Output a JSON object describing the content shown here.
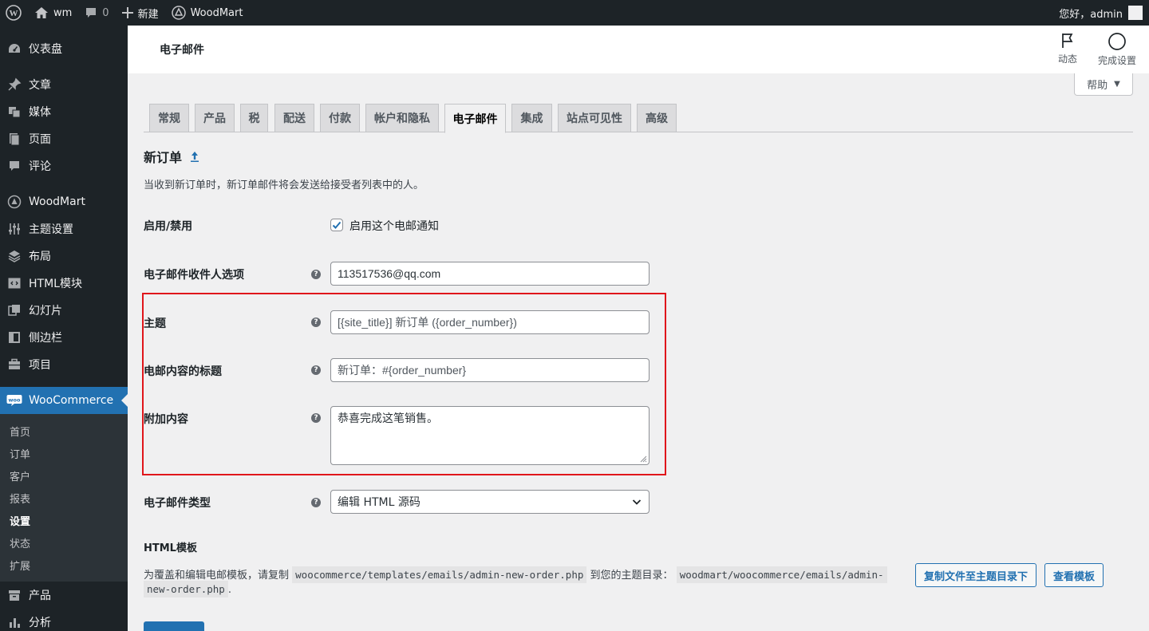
{
  "adminbar": {
    "site_name": "wm",
    "comments_count": "0",
    "new_label": "新建",
    "theme_link": "WoodMart",
    "greeting": "您好，admin"
  },
  "sidebar": {
    "items": [
      {
        "label": "仪表盘",
        "icon": "dashboard-icon"
      },
      {
        "label": "文章",
        "icon": "pin-icon"
      },
      {
        "label": "媒体",
        "icon": "media-icon"
      },
      {
        "label": "页面",
        "icon": "page-icon"
      },
      {
        "label": "评论",
        "icon": "comment-icon"
      },
      {
        "label": "WoodMart",
        "icon": "woodmart-icon"
      },
      {
        "label": "主题设置",
        "icon": "sliders-icon"
      },
      {
        "label": "布局",
        "icon": "layers-icon"
      },
      {
        "label": "HTML模块",
        "icon": "html-block-icon"
      },
      {
        "label": "幻灯片",
        "icon": "slides-icon"
      },
      {
        "label": "侧边栏",
        "icon": "sidebar-icon"
      },
      {
        "label": "项目",
        "icon": "portfolio-icon"
      },
      {
        "label": "WooCommerce",
        "icon": "woo-icon"
      },
      {
        "label": "产品",
        "icon": "archive-icon"
      },
      {
        "label": "分析",
        "icon": "chart-icon"
      }
    ],
    "submenu": [
      "首页",
      "订单",
      "客户",
      "报表",
      "设置",
      "状态",
      "扩展"
    ]
  },
  "header": {
    "title": "电子邮件",
    "activity_label": "动态",
    "finish_setup_label": "完成设置",
    "help_label": "帮助"
  },
  "tabs": [
    "常规",
    "产品",
    "税",
    "配送",
    "付款",
    "帐户和隐私",
    "电子邮件",
    "集成",
    "站点可见性",
    "高级"
  ],
  "active_tab": "电子邮件",
  "form": {
    "section_title": "新订单",
    "description": "当收到新订单时，新订单邮件将会发送给接受者列表中的人。",
    "enable_label": "启用/禁用",
    "enable_checkbox_label": "启用这个电邮通知",
    "enable_checked": true,
    "recipient_label": "电子邮件收件人选项",
    "recipient_value": "113517536@qq.com",
    "subject_label": "主题",
    "subject_placeholder": "[{site_title}] 新订单 ({order_number})",
    "heading_label": "电邮内容的标题",
    "heading_placeholder": "新订单：#{order_number}",
    "additional_label": "附加内容",
    "additional_value": "恭喜完成这笔销售。",
    "type_label": "电子邮件类型",
    "type_value": "编辑 HTML 源码"
  },
  "template": {
    "title": "HTML模板",
    "text_before": "为覆盖和编辑电邮模板，请复制",
    "source_path": "woocommerce/templates/emails/admin-new-order.php",
    "text_middle": "到您的主题目录：",
    "dest_path_1": "woodmart/woocommerce/emails/admin-",
    "dest_path_2": "new-order.php",
    "text_end": ".",
    "copy_button": "复制文件至主题目录下",
    "view_button": "查看模板"
  },
  "colors": {
    "accent": "#2271b1",
    "highlight_border": "#e0161b",
    "admin_dark": "#1d2327"
  }
}
